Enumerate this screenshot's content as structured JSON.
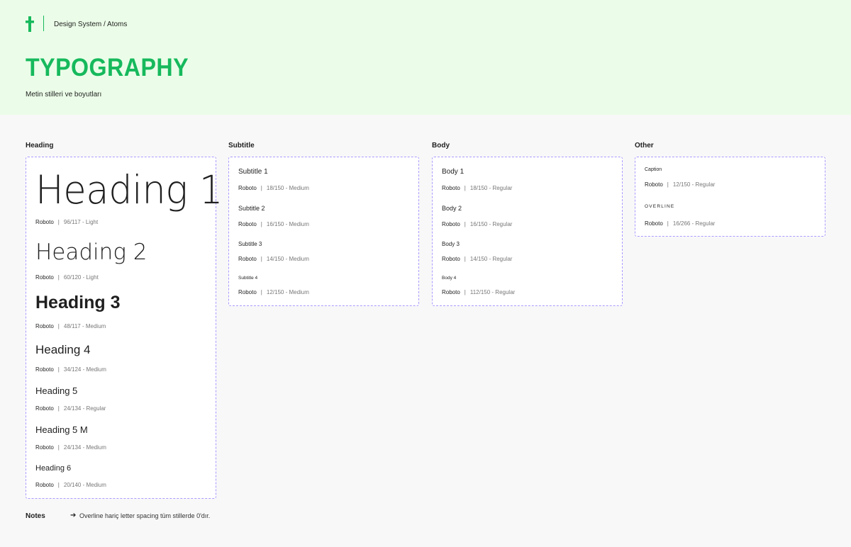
{
  "breadcrumb": "Design System / Atoms",
  "title": "TYPOGRAPHY",
  "subtitle": "Metin stilleri ve boyutları",
  "colors": {
    "accent": "#16b95c",
    "hero_bg": "#ebfde8",
    "card_border": "#a99bff"
  },
  "separator": "|",
  "columns": {
    "heading": {
      "title": "Heading",
      "items": [
        {
          "sample": "Heading 1",
          "font": "Roboto",
          "meta": "96/117 - Light"
        },
        {
          "sample": "Heading 2",
          "font": "Roboto",
          "meta": "60/120 - Light"
        },
        {
          "sample": "Heading 3",
          "font": "Roboto",
          "meta": "48/117 - Medium"
        },
        {
          "sample": "Heading 4",
          "font": "Roboto",
          "meta": "34/124 - Medium"
        },
        {
          "sample": "Heading 5",
          "font": "Roboto",
          "meta": "24/134 - Regular"
        },
        {
          "sample": "Heading 5 M",
          "font": "Roboto",
          "meta": "24/134 - Medium"
        },
        {
          "sample": "Heading 6",
          "font": "Roboto",
          "meta": "20/140 - Medium"
        }
      ]
    },
    "subtitle": {
      "title": "Subtitle",
      "items": [
        {
          "sample": "Subtitle 1",
          "font": "Roboto",
          "meta": "18/150 - Medium"
        },
        {
          "sample": "Subtitle 2",
          "font": "Roboto",
          "meta": "16/150 - Medium"
        },
        {
          "sample": "Subtitle 3",
          "font": "Roboto",
          "meta": "14/150 - Medium"
        },
        {
          "sample": "Subtitle 4",
          "font": "Roboto",
          "meta": "12/150 - Medium"
        }
      ]
    },
    "body": {
      "title": "Body",
      "items": [
        {
          "sample": "Body 1",
          "font": "Roboto",
          "meta": "18/150 - Regular"
        },
        {
          "sample": "Body 2",
          "font": "Roboto",
          "meta": "16/150 - Regular"
        },
        {
          "sample": "Body 3",
          "font": "Roboto",
          "meta": "14/150 - Regular"
        },
        {
          "sample": "Body 4",
          "font": "Roboto",
          "meta": "112/150 - Regular"
        }
      ]
    },
    "other": {
      "title": "Other",
      "items": [
        {
          "sample": "Caption",
          "font": "Roboto",
          "meta": "12/150 - Regular"
        },
        {
          "sample": "OVERLINE",
          "font": "Roboto",
          "meta": "16/266 - Regular"
        }
      ]
    }
  },
  "notes": {
    "label": "Notes",
    "arrow": "➔",
    "text": "Overline hariç letter spacing tüm stillerde 0'dır."
  }
}
